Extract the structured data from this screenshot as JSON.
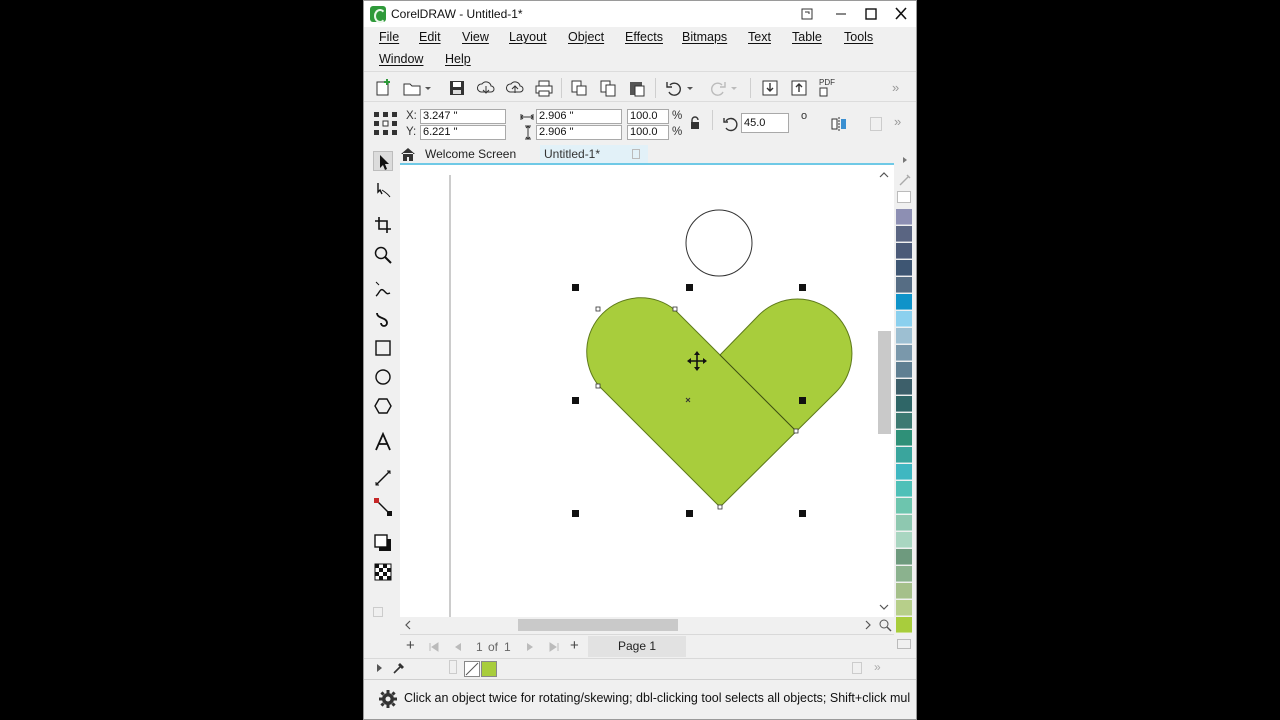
{
  "window": {
    "title": "CorelDRAW - Untitled-1*"
  },
  "menu": {
    "items": [
      "File",
      "Edit",
      "View",
      "Layout",
      "Object",
      "Effects",
      "Bitmaps",
      "Text",
      "Table",
      "Tools",
      "Window",
      "Help"
    ]
  },
  "toolbar": {
    "pdf_label": "PDF"
  },
  "properties": {
    "x_label": "X:",
    "y_label": "Y:",
    "x_value": "3.247 \"",
    "y_value": "6.221 \"",
    "width_value": "2.906 \"",
    "height_value": "2.906 \"",
    "scale_x": "100.0",
    "scale_y": "100.0",
    "percent_symbol": "%",
    "rotation": "45.0",
    "degree_symbol": "o"
  },
  "tabs": {
    "welcome": "Welcome Screen",
    "document": "Untitled-1*"
  },
  "page_nav": {
    "current": "1",
    "of_label": "of",
    "total": "1",
    "page_tab": "Page 1"
  },
  "status": {
    "text": "Click an object twice for rotating/skewing; dbl-clicking tool selects all objects; Shift+click multi-se"
  },
  "colors": {
    "heart_fill": "#a8cd3c",
    "accent_tab_line": "#6fc9e6",
    "app_logo": "#2f9a3a",
    "palette": [
      "#8d8fb3",
      "#5a6582",
      "#4b5a78",
      "#3e5673",
      "#566d84",
      "#0f93c9",
      "#8bd0ee",
      "#9dbfd2",
      "#7a98ab",
      "#5f7f92",
      "#3d5f6a",
      "#2f6667",
      "#3d7a72",
      "#2f9078",
      "#3aa59d",
      "#3fb7c1",
      "#4fc0b8",
      "#6dc5ae",
      "#8ec8b0",
      "#a9d6c1",
      "#6e9a7e",
      "#8bb28e",
      "#a5c08a",
      "#b7cf8a",
      "#a8cd3c"
    ]
  }
}
